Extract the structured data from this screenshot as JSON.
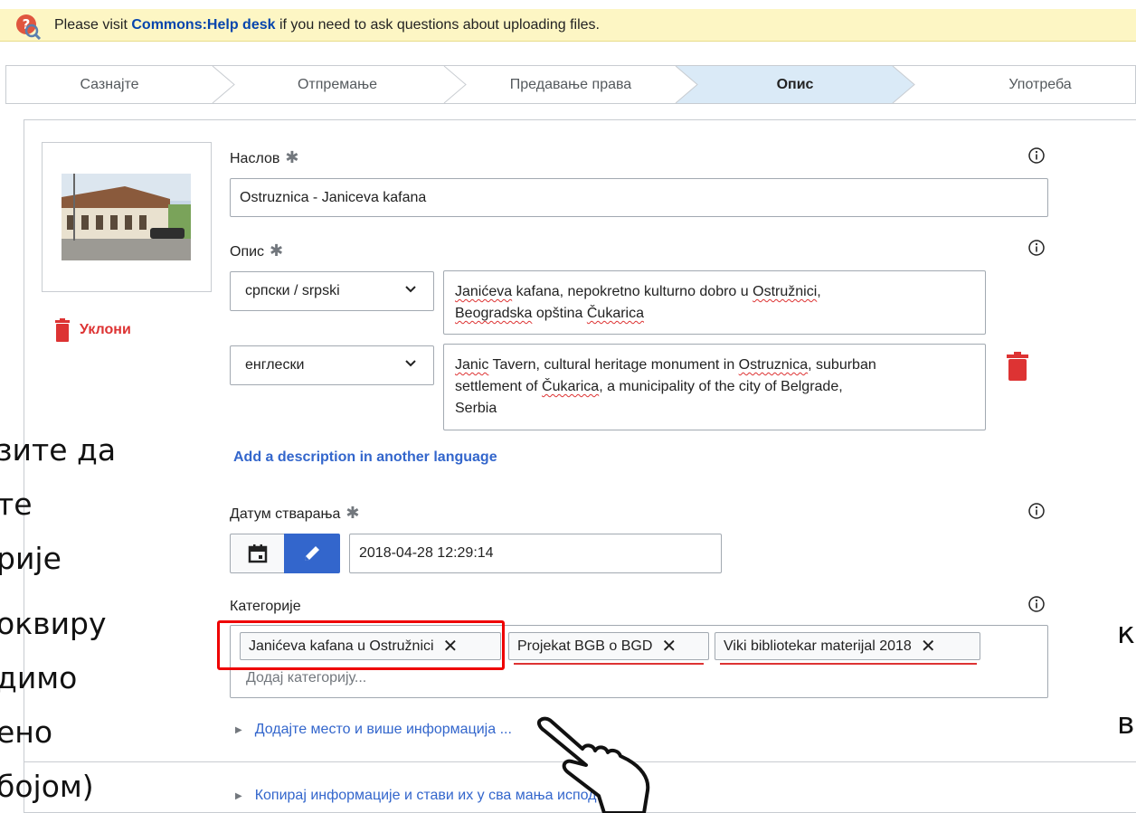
{
  "notice": {
    "prefix": "Please visit",
    "link": "Commons:Help desk",
    "suffix": "if you need to ask questions about uploading files."
  },
  "steps": [
    {
      "label": "Сазнајте",
      "active": false
    },
    {
      "label": "Отпремање",
      "active": false
    },
    {
      "label": "Предавање права",
      "active": false
    },
    {
      "label": "Опис",
      "active": true
    },
    {
      "label": "Употреба",
      "active": false
    }
  ],
  "remove_label": "Уклони",
  "title_field": {
    "label": "Наслов",
    "required_mark": "✱",
    "value": "Ostruznica - Janiceva kafana"
  },
  "description": {
    "label": "Опис",
    "required_mark": "✱",
    "entries": [
      {
        "language": "српски / srpski",
        "text_parts": [
          "Janićeva",
          " kafana, nepokretno kulturno dobro u ",
          "Ostružnici",
          ",",
          "Beogradska",
          " opština ",
          "Čukarica"
        ]
      },
      {
        "language": "енглески",
        "text_parts": [
          "Janic",
          " Tavern, cultural heritage monument in ",
          "Ostruznica",
          ", suburban",
          "settlement of ",
          "Čukarica",
          ", a municipality of the city of Belgrade,",
          "Serbia"
        ]
      }
    ],
    "add_language_label": "Add a description in another language"
  },
  "date_field": {
    "label": "Датум стварања",
    "required_mark": "✱",
    "value": "2018-04-28 12:29:14"
  },
  "categories": {
    "label": "Категорије",
    "chips": [
      "Janićeva kafana u Ostružnici",
      "Projekat BGB o BGD",
      "Viki bibliotekar materijal 2018"
    ],
    "placeholder": "Додај категорију..."
  },
  "expanders": {
    "more_info": "Додајте место и више информација ...",
    "copy_info": "Копирај информације и стави их у сва                мања испод ..."
  },
  "overlay_left_lines": [
    "зите да",
    "те",
    "рије",
    "оквиру",
    "димо",
    "ено",
    "бојом)"
  ],
  "overlay_right_lines": [
    "к",
    "в"
  ],
  "colors": {
    "notice_bg": "#fdf6c4",
    "link_blue": "#36c",
    "danger_red": "#d33",
    "highlight_red": "#e00"
  },
  "icons": [
    "help-question-icon",
    "trash-icon",
    "info-icon",
    "chevron-down-icon",
    "calendar-icon",
    "pencil-icon",
    "close-icon",
    "pointing-hand-icon"
  ]
}
